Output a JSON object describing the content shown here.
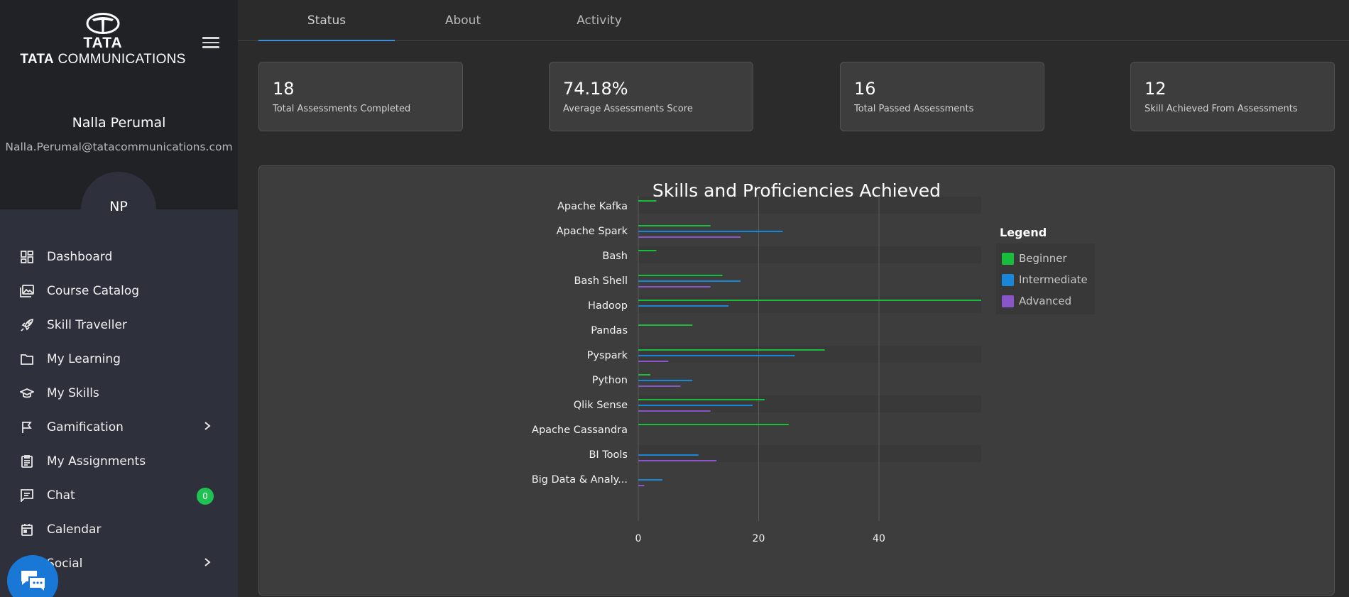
{
  "brand": {
    "logo_top": "TATA",
    "logo_bottom_bold": "TATA",
    "logo_bottom_rest": " COMMUNICATIONS"
  },
  "user": {
    "name": "Nalla Perumal",
    "email": "Nalla.Perumal@tatacommunications.com",
    "initials": "NP"
  },
  "nav": {
    "items": [
      {
        "label": "Dashboard",
        "icon": "dashboard-icon"
      },
      {
        "label": "Course Catalog",
        "icon": "image-stack-icon"
      },
      {
        "label": "Skill Traveller",
        "icon": "rocket-icon"
      },
      {
        "label": "My Learning",
        "icon": "folder-icon"
      },
      {
        "label": "My Skills",
        "icon": "graduation-cap-icon"
      },
      {
        "label": "Gamification",
        "icon": "flag-icon"
      },
      {
        "label": "My Assignments",
        "icon": "clipboard-icon"
      },
      {
        "label": "Chat",
        "icon": "chat-icon"
      },
      {
        "label": "Calendar",
        "icon": "calendar-icon"
      },
      {
        "label": "Social",
        "icon": "people-icon"
      }
    ],
    "chat_badge": "0"
  },
  "tabs": {
    "status": "Status",
    "about": "About",
    "activity": "Activity",
    "active": "Status"
  },
  "stats": [
    {
      "value": "18",
      "label": "Total Assessments Completed"
    },
    {
      "value": "74.18%",
      "label": "Average Assessments Score"
    },
    {
      "value": "16",
      "label": "Total Passed Assessments"
    },
    {
      "value": "12",
      "label": "Skill Achieved From Assessments"
    }
  ],
  "colors": {
    "beginner": "#19bd3c",
    "intermediate": "#1a86d8",
    "advanced": "#8a55c8",
    "accent": "#3b8fde"
  },
  "chart": {
    "title": "Skills and Proficiencies Achieved",
    "legend_title": "Legend"
  },
  "chart_data": {
    "type": "bar",
    "orientation": "horizontal",
    "title": "Skills and Proficiencies Achieved",
    "categories": [
      "Apache Kafka",
      "Apache Spark",
      "Bash",
      "Bash Shell",
      "Hadoop",
      "Pandas",
      "Pyspark",
      "Python",
      "Qlik Sense",
      "Apache Cassandra",
      "BI Tools",
      "Big Data & Analy..."
    ],
    "series": [
      {
        "name": "Beginner",
        "values": [
          3,
          12,
          3,
          14,
          57,
          9,
          31,
          2,
          21,
          25,
          0,
          0
        ]
      },
      {
        "name": "Intermediate",
        "values": [
          0,
          24,
          0,
          17,
          15,
          0,
          26,
          9,
          19,
          0,
          10,
          4
        ]
      },
      {
        "name": "Advanced",
        "values": [
          0,
          17,
          0,
          12,
          0,
          0,
          5,
          7,
          12,
          0,
          13,
          1
        ]
      }
    ],
    "x_ticks": [
      "0",
      "20",
      "40"
    ],
    "xlim": [
      0,
      57
    ],
    "grid": true,
    "legend_position": "right"
  }
}
